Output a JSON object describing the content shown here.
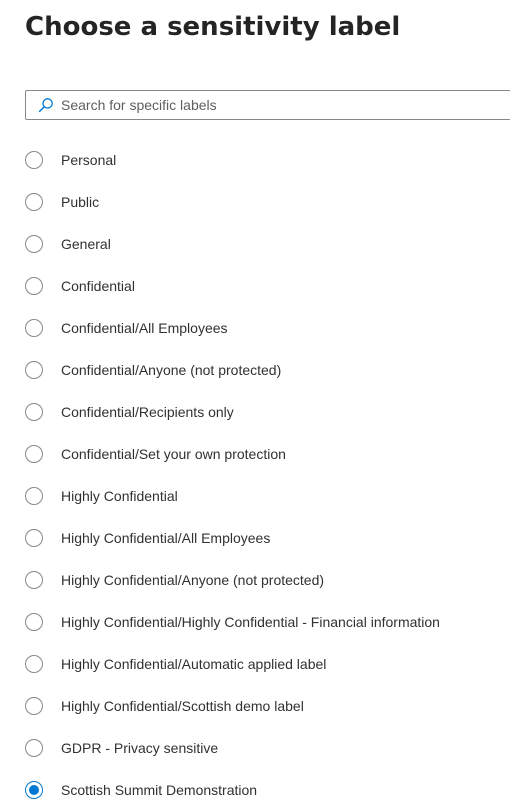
{
  "dialog": {
    "title": "Choose a sensitivity label"
  },
  "search": {
    "placeholder": "Search for specific labels",
    "value": "",
    "icon": "search-icon"
  },
  "colors": {
    "accent": "#0078d4",
    "text": "#323130",
    "border": "#8a8886"
  },
  "labels": [
    {
      "label": "Personal",
      "selected": false
    },
    {
      "label": "Public",
      "selected": false
    },
    {
      "label": "General",
      "selected": false
    },
    {
      "label": "Confidential",
      "selected": false
    },
    {
      "label": "Confidential/All Employees",
      "selected": false
    },
    {
      "label": "Confidential/Anyone (not protected)",
      "selected": false
    },
    {
      "label": "Confidential/Recipients only",
      "selected": false
    },
    {
      "label": "Confidential/Set your own protection",
      "selected": false
    },
    {
      "label": "Highly Confidential",
      "selected": false
    },
    {
      "label": "Highly Confidential/All Employees",
      "selected": false
    },
    {
      "label": "Highly Confidential/Anyone (not protected)",
      "selected": false
    },
    {
      "label": "Highly Confidential/Highly Confidential - Financial information",
      "selected": false
    },
    {
      "label": "Highly Confidential/Automatic applied label",
      "selected": false
    },
    {
      "label": "Highly Confidential/Scottish demo label",
      "selected": false
    },
    {
      "label": "GDPR - Privacy sensitive",
      "selected": false
    },
    {
      "label": "Scottish Summit Demonstration",
      "selected": true
    }
  ]
}
